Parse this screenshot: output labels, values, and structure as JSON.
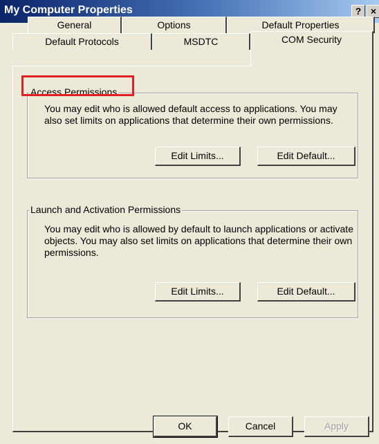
{
  "window": {
    "title": "My Computer Properties",
    "help_label": "?",
    "close_label": "×"
  },
  "tabs": {
    "row1": [
      "General",
      "Options",
      "Default Properties"
    ],
    "row2": [
      "Default Protocols",
      "MSDTC",
      "COM Security"
    ],
    "active": "COM Security"
  },
  "access": {
    "title": "Access Permissions",
    "description": "You may edit who is allowed default access to applications. You may also set limits on applications that determine their own permissions.",
    "edit_limits": "Edit Limits...",
    "edit_default": "Edit Default..."
  },
  "launch": {
    "title": "Launch and Activation Permissions",
    "description": "You may edit who is allowed by default to launch applications or activate objects. You may also set limits on applications that determine their own permissions.",
    "edit_limits": "Edit Limits...",
    "edit_default": "Edit Default..."
  },
  "footer": {
    "ok": "OK",
    "cancel": "Cancel",
    "apply": "Apply"
  },
  "colors": {
    "highlight": "#e02020",
    "title_bar_start": "#0a246a"
  }
}
